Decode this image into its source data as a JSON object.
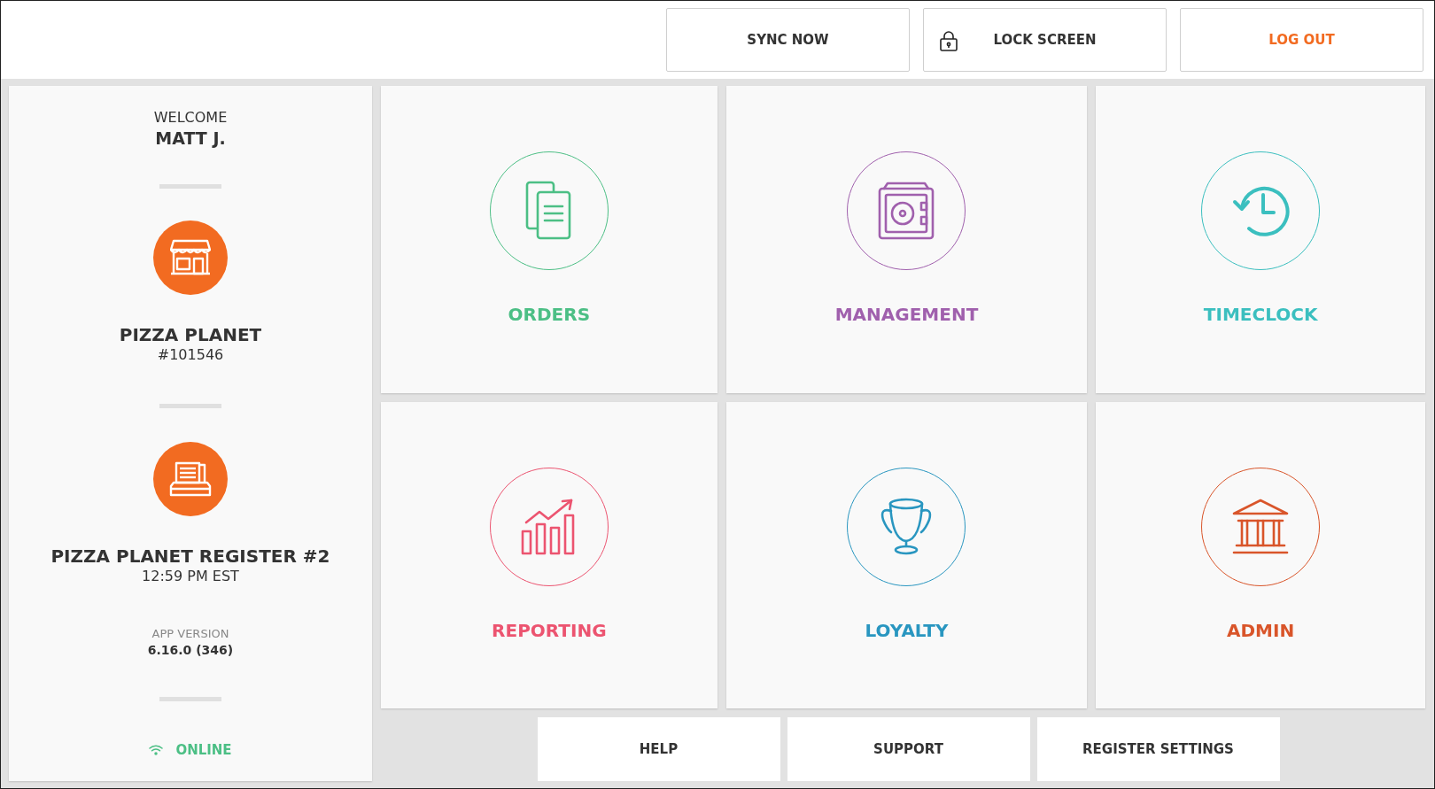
{
  "top_bar": {
    "buttons": [
      {
        "label": "SYNC NOW",
        "kind": "plain"
      },
      {
        "label": "LOCK SCREEN",
        "kind": "lock"
      },
      {
        "label": "LOG OUT",
        "kind": "accent"
      }
    ]
  },
  "sidebar": {
    "welcome": "WELCOME",
    "user": "MATT J.",
    "store_name": "PIZZA PLANET",
    "store_number": "#101546",
    "register_name": "PIZZA PLANET REGISTER #2",
    "time": "12:59 PM EST",
    "version_label": "APP VERSION",
    "version": "6.16.0 (346)",
    "status": {
      "label": "ONLINE",
      "online": true
    }
  },
  "tiles": [
    {
      "label": "ORDERS",
      "color": "#4cbf85"
    },
    {
      "label": "MANAGEMENT",
      "color": "#a060ad"
    },
    {
      "label": "TIMECLOCK",
      "color": "#3bbfbf"
    },
    {
      "label": "REPORTING",
      "color": "#ec5470"
    },
    {
      "label": "LOYALTY",
      "color": "#2996c0"
    },
    {
      "label": "ADMIN",
      "color": "#d9552a"
    }
  ],
  "bottom_buttons": [
    "HELP",
    "SUPPORT",
    "REGISTER SETTINGS"
  ]
}
